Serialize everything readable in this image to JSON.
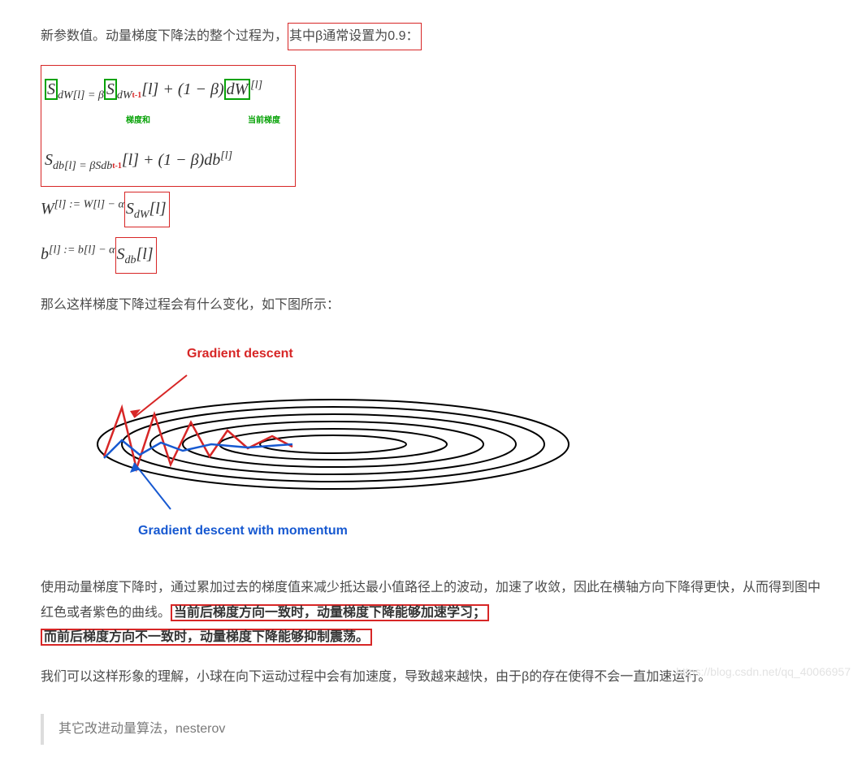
{
  "p_top_a": "新参数值。动量梯度下降法的整个过程为，",
  "p_top_b": "其中β通常设置为0.9：",
  "eq1_pre": "S",
  "eq1_a": "dW[l]  =  β",
  "eq1_S": "S",
  "eq1_b": "dW",
  "eq1_t1": "t-1",
  "eq1_c": "[l]  +  (1 − β)",
  "eq1_dW": "dW",
  "eq1_d": "[l]",
  "green1": "梯度和",
  "green2": "当前梯度",
  "eq2_a": "S",
  "eq2_b": "db[l]  =  βS",
  "eq2_c": "db",
  "eq2_t1": "t-1",
  "eq2_d": "[l]  +  (1 − β)db",
  "eq2_e": "[l]",
  "eq3_a": "W",
  "eq3_b": "[l]  :=  W",
  "eq3_c": "[l]  −  α",
  "eq3_box": "SdW[l]",
  "eq4_a": "b",
  "eq4_b": "[l]  :=  b",
  "eq4_c": "[l]  −  α",
  "eq4_box": "Sdb[l]",
  "p_mid": "那么这样梯度下降过程会有什么变化，如下图所示：",
  "chart_data": {
    "type": "diagram",
    "labels": {
      "red": "Gradient descent",
      "blue": "Gradient descent with momentum"
    },
    "description": "Concentric elongated ellipses (loss contours). A red zig-zag path enters from the left bouncing vertically while slowly moving right (plain gradient descent). A smoother blue path with small oscillation enters similarly but with far less vertical bounce (gradient descent with momentum)."
  },
  "lbl_red": "Gradient descent",
  "lbl_blue": "Gradient descent with momentum",
  "p_after_a": "使用动量梯度下降时，通过累加过去的梯度值来减少抵达最小值路径上的波动，加速了收敛，因此在横轴方向下降得更快，从而得到图中红色或者紫色的曲线。",
  "p_after_b1": "当前后梯度方向一致时，动量梯度下降能够加速学习；",
  "p_after_b2": "而前后梯度方向不一致时，动量梯度下降能够抑制震荡。",
  "p_last": "我们可以这样形象的理解，小球在向下运动过程中会有加速度，导致越来越快，由于β的存在使得不会一直加速运行。",
  "footer": "其它改进动量算法，nesterov",
  "watermark": "https://blog.csdn.net/qq_40066957"
}
